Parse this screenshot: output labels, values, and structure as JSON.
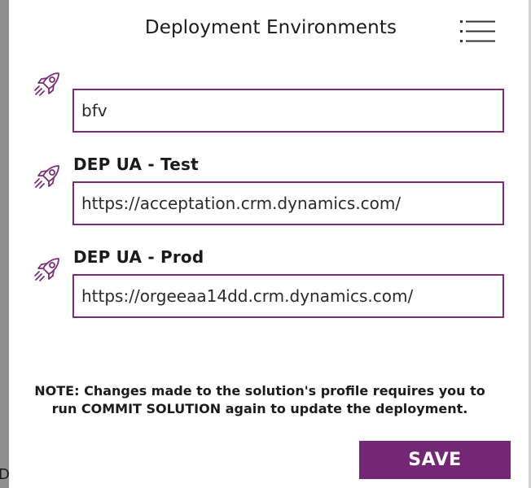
{
  "dialog": {
    "title": "Deployment Environments",
    "menu_icon": "hamburger-menu-icon"
  },
  "environments": [
    {
      "icon": "rocket-icon",
      "label": "",
      "url": "bfv"
    },
    {
      "icon": "rocket-icon",
      "label": "DEP UA - Test",
      "url": "https://acceptation.crm.dynamics.com/"
    },
    {
      "icon": "rocket-icon",
      "label": "DEP UA - Prod",
      "url": "https://orgeeaa14dd.crm.dynamics.com/"
    }
  ],
  "note": {
    "line1": "NOTE: Changes made to the solution's profile requires you to",
    "line2": "run COMMIT SOLUTION again to update the deployment."
  },
  "save_button": {
    "label": "SAVE"
  },
  "background": {
    "edge_letter": "D"
  },
  "colors": {
    "accent": "#742774",
    "input_border": "#7a2e78",
    "text": "#1b1b1b"
  }
}
